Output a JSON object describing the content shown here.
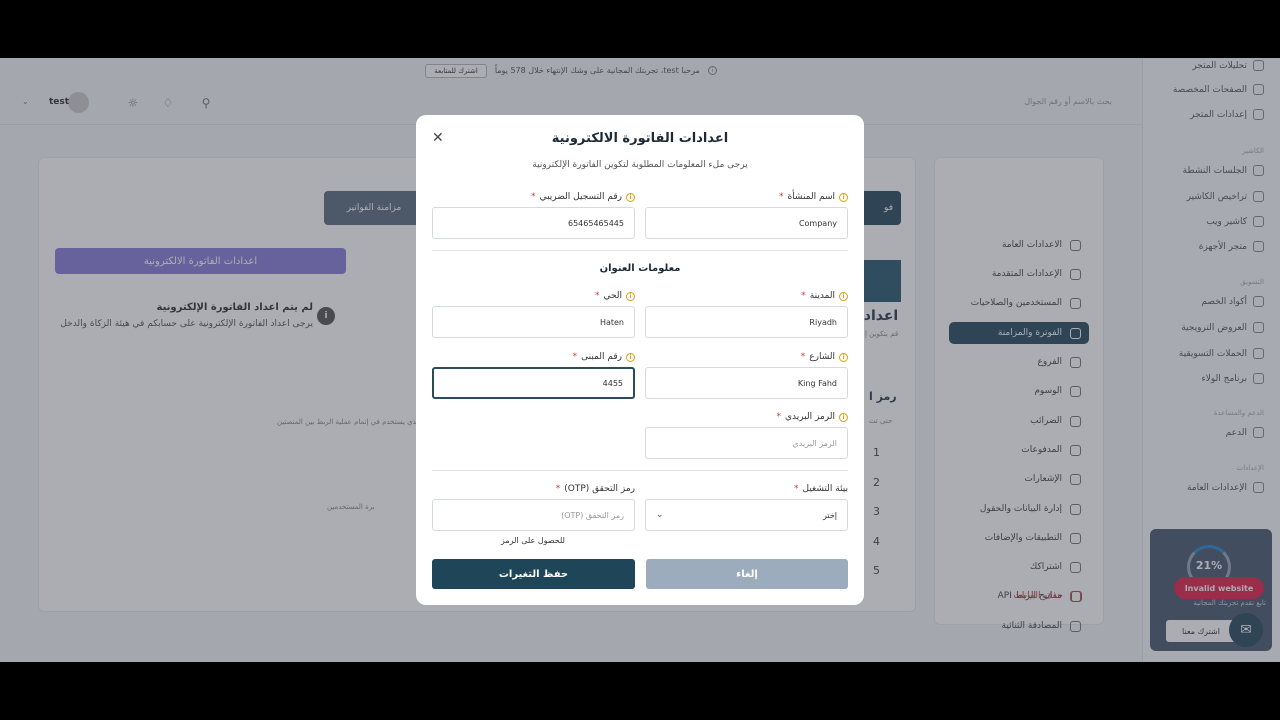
{
  "banner": {
    "text": "مرحبا test، تجربتك المجانية على وشك الإنتهاء خلال 578 يوماً",
    "subscribe_label": "اشترك للمتابعة"
  },
  "header": {
    "search_placeholder": "بحث بالاسم أو رقم الجوال",
    "user_name": "test"
  },
  "sidebar": {
    "items_top": [
      "تحليلات المتجر",
      "الصفحات المخصصة",
      "إعدادات المتجر"
    ],
    "section_cashier": "الكاشير",
    "items_cashier": [
      "الجلسات النشطة",
      "تراخيص الكاشير",
      "كاشير ويب",
      "متجر الأجهزة"
    ],
    "section_marketing": "التسويق",
    "items_marketing": [
      "أكواد الخصم",
      "العروض الترويجية",
      "الحملات التسويقية",
      "برنامج الولاء"
    ],
    "section_help": "الدعم والمساعدة",
    "items_help": [
      "الدعم"
    ],
    "section_general": "الإعدادات",
    "items_general": [
      "الإعدادات العامة"
    ]
  },
  "settings_nav": {
    "items": [
      "الاعدادات العامة",
      "الإعدادات المتقدمة",
      "المستخدمين والصلاحيات",
      "الفوترة والمزامنة",
      "الفروع",
      "الوسوم",
      "الضرائب",
      "المدفوعات",
      "الإشعارات",
      "إدارة البيانات والحقول",
      "التطبيقات والإضافات",
      "اشتراكك",
      "مفاتيح الربط API",
      "المصادقة الثنائية",
      "حذف البيانات"
    ]
  },
  "main": {
    "invoices_btn": "فو",
    "sync_btn": "مزامنة الفواتير",
    "einvoice_settings_btn": "اعدادات الفاتورة الالكترونية",
    "warning_title": "لم يتم اعداد الفاتورة الإلكترونية",
    "warning_desc": "يرجى اعداد الفاتورة الإلكترونية على حسابكم في هيئة الزكاة والدخل",
    "side_heading": "اعدادا",
    "side_sub": "قم بتكوين إ",
    "otp_heading": "رمز ا",
    "otp_sub": "حتى تت",
    "faded_note": "الذي يستخدم في إتمام عملية الربط بين المنصتين",
    "faded_note2": "برة المستخدمين",
    "steps": [
      "1",
      "2",
      "3",
      "4",
      "5"
    ]
  },
  "widget": {
    "percent": "21%",
    "invalid_label": "Invalid website",
    "trial_text": "تابع تقدم تجربتك المجانية",
    "join_label": "اشترك معنا"
  },
  "modal": {
    "title": "اعدادات الفاتورة الالكترونية",
    "subtitle": "يرجى ملء المعلومات المطلوبة لتكوين الفاتورة الإلكترونية",
    "fields": {
      "company_name": {
        "label": "اسم المنشأة",
        "value": "Company"
      },
      "tax_number": {
        "label": "رقم التسجيل الضريبي",
        "value": "65465465445"
      },
      "city": {
        "label": "المدينة",
        "value": "Riyadh"
      },
      "district": {
        "label": "الحي",
        "value": "Haten"
      },
      "street": {
        "label": "الشارع",
        "value": "King Fahd"
      },
      "building": {
        "label": "رقم المبنى",
        "value": "4455"
      },
      "postal": {
        "label": "الرمز البريدي",
        "value": "",
        "placeholder": "الرمز البريدي"
      },
      "environment": {
        "label": "بيئة التشغيل",
        "value": "إختر"
      },
      "otp": {
        "label": "رمز التحقق (OTP)",
        "value": "",
        "placeholder": "رمز التحقق (OTP)"
      }
    },
    "address_section": "معلومات العنوان",
    "otp_link": "للحصول على الرمز",
    "cancel_label": "إلغاء",
    "save_label": "حفظ التغيرات",
    "required_mark": "*",
    "info_mark": "i"
  }
}
